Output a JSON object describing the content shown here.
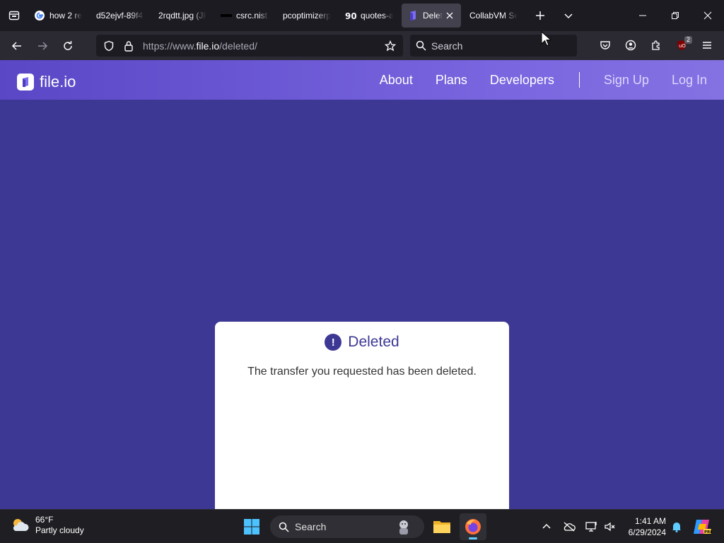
{
  "browser": {
    "tabs": [
      {
        "title": "how 2 re",
        "favicon": "google-icon"
      },
      {
        "title": "d52ejvf-89f4",
        "favicon": "none"
      },
      {
        "title": "2rqdtt.jpg (JP",
        "favicon": "none"
      },
      {
        "title": "csrc.nist.",
        "favicon": "nist-icon"
      },
      {
        "title": "pcoptimizerp",
        "favicon": "none"
      },
      {
        "title": "quotes-a",
        "favicon": "quotes-icon"
      },
      {
        "title": "Delete",
        "favicon": "fileio-icon",
        "active": true
      },
      {
        "title": "CollabVM Se",
        "favicon": "none"
      }
    ],
    "url": {
      "prefix": "https://www.",
      "domain": "file.io",
      "path": "/deleted/"
    },
    "search_placeholder": "Search",
    "extension_badge": "2"
  },
  "site": {
    "logo_text": "file.io",
    "nav": {
      "about": "About",
      "plans": "Plans",
      "developers": "Developers",
      "signup": "Sign Up",
      "login": "Log In"
    }
  },
  "card": {
    "icon": "!",
    "title": "Deleted",
    "message": "The transfer you requested has been deleted."
  },
  "taskbar": {
    "weather_temp": "66°F",
    "weather_desc": "Partly cloudy",
    "search_label": "Search",
    "time": "1:41 AM",
    "date": "6/29/2024"
  },
  "colors": {
    "page_bg": "#3e3895",
    "header_gradient_start": "#5947c6",
    "header_gradient_end": "#8472e2",
    "card_accent": "#3e3895"
  }
}
